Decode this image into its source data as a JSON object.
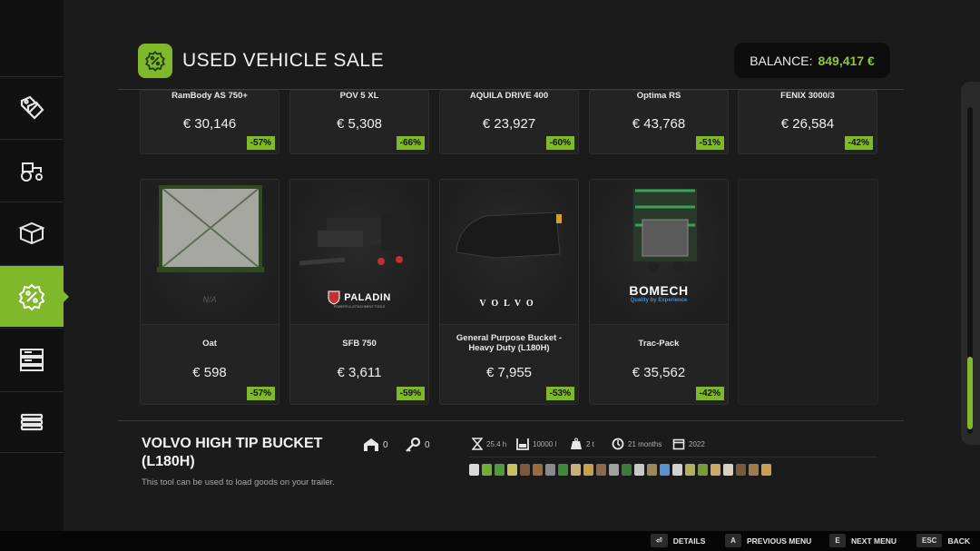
{
  "header": {
    "title": "USED VEHICLE SALE",
    "balance_label": "BALANCE:",
    "balance_value": "849,417 €"
  },
  "sidebar": {
    "items": [
      {
        "icon": "price-tags-icon",
        "active": false
      },
      {
        "icon": "tractor-icon",
        "active": false
      },
      {
        "icon": "storage-box-icon",
        "active": false
      },
      {
        "icon": "discount-badge-icon",
        "active": true
      },
      {
        "icon": "server-list-icon",
        "active": false
      },
      {
        "icon": "stack-list-icon",
        "active": false
      }
    ]
  },
  "top_row": [
    {
      "name": "RamBody AS 750+",
      "price": "€ 30,146",
      "discount": "-57%"
    },
    {
      "name": "POV 5 XL",
      "price": "€ 5,308",
      "discount": "-66%"
    },
    {
      "name": "AQUILA DRIVE 400",
      "price": "€ 23,927",
      "discount": "-60%"
    },
    {
      "name": "Optima RS",
      "price": "€ 43,768",
      "discount": "-51%"
    },
    {
      "name": "FENIX 3000/3",
      "price": "€ 26,584",
      "discount": "-42%"
    }
  ],
  "bottom_row": [
    {
      "name": "Oat",
      "price": "€ 598",
      "discount": "-57%",
      "brand": "N/A"
    },
    {
      "name": "SFB 750",
      "price": "€ 3,611",
      "discount": "-59%",
      "brand": "PALADIN",
      "brand_sub": "POWERFUL ATTACHMENT TOOLS"
    },
    {
      "name": "General Purpose Bucket - Heavy Duty (L180H)",
      "price": "€ 7,955",
      "discount": "-53%",
      "brand": "VOLVO"
    },
    {
      "name": "Trac-Pack",
      "price": "€ 35,562",
      "discount": "-42%",
      "brand": "BOMECH",
      "brand_sub": "Quality by Experience"
    }
  ],
  "details": {
    "title": "VOLVO HIGH TIP BUCKET (L180H)",
    "description": "This tool can be used to load goods on your trailer.",
    "garage_count": "0",
    "key_count": "0",
    "stats": {
      "hours": "25.4 h",
      "capacity": "10000 l",
      "weight": "2 t",
      "age": "21 months",
      "year": "2022"
    },
    "fill_type_colors": [
      "#d9d9d9",
      "#6fae3a",
      "#4f9a3a",
      "#c9c25a",
      "#7a5a3a",
      "#9a6a3a",
      "#8a8a8a",
      "#3f8a3a",
      "#c9b07a",
      "#c7a14a",
      "#8a6a4a",
      "#a0a0a0",
      "#3e7a3a",
      "#c9c9c9",
      "#9a8a5a",
      "#5a8fd0",
      "#d0d0d0",
      "#b0b060",
      "#7a9a3a",
      "#caa86a",
      "#d7d2c0",
      "#7a5a3a",
      "#a07a4a",
      "#c9a050"
    ]
  },
  "bottom_bar": {
    "details": {
      "key": "⏎",
      "label": "DETAILS"
    },
    "prev": {
      "key": "A",
      "label": "PREVIOUS MENU"
    },
    "next": {
      "key": "E",
      "label": "NEXT MENU"
    },
    "back": {
      "key": "ESC",
      "label": "BACK"
    }
  }
}
